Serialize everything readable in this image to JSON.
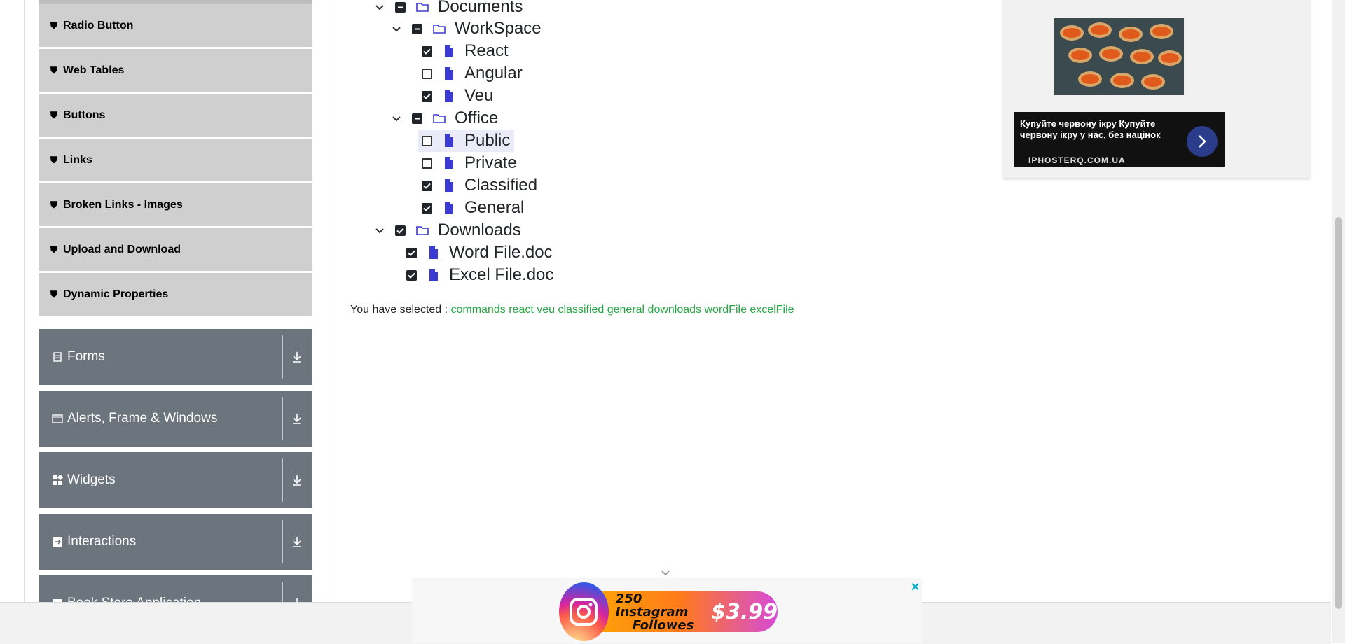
{
  "sidebar": {
    "elements_items": [
      {
        "label": "Radio Button"
      },
      {
        "label": "Web Tables"
      },
      {
        "label": "Buttons"
      },
      {
        "label": "Links"
      },
      {
        "label": "Broken Links - Images"
      },
      {
        "label": "Upload and Download"
      },
      {
        "label": "Dynamic Properties"
      }
    ],
    "groups": [
      {
        "label": "Forms",
        "icon": "form-icon"
      },
      {
        "label": "Alerts, Frame & Windows",
        "icon": "window-icon"
      },
      {
        "label": "Widgets",
        "icon": "widgets-icon"
      },
      {
        "label": "Interactions",
        "icon": "interactions-icon"
      },
      {
        "label": "Book Store Application",
        "icon": "book-icon"
      }
    ]
  },
  "tree": {
    "nodes": [
      {
        "label": "Documents",
        "state": "half",
        "type": "folder",
        "expanded": true
      },
      {
        "label": "WorkSpace",
        "state": "half",
        "type": "folder",
        "expanded": true
      },
      {
        "label": "React",
        "state": "checked",
        "type": "file"
      },
      {
        "label": "Angular",
        "state": "unchecked",
        "type": "file"
      },
      {
        "label": "Veu",
        "state": "checked",
        "type": "file"
      },
      {
        "label": "Office",
        "state": "half",
        "type": "folder",
        "expanded": true
      },
      {
        "label": "Public",
        "state": "unchecked",
        "type": "file",
        "highlighted": true
      },
      {
        "label": "Private",
        "state": "unchecked",
        "type": "file"
      },
      {
        "label": "Classified",
        "state": "checked",
        "type": "file"
      },
      {
        "label": "General",
        "state": "checked",
        "type": "file"
      },
      {
        "label": "Downloads",
        "state": "checked",
        "type": "folder",
        "expanded": true
      },
      {
        "label": "Word File.doc",
        "state": "checked",
        "type": "file"
      },
      {
        "label": "Excel File.doc",
        "state": "checked",
        "type": "file"
      }
    ]
  },
  "result": {
    "prefix": "You have selected :",
    "values": "commands react veu classified general downloads wordFile excelFile"
  },
  "side_ad": {
    "text": "Купуйте червону ікру Купуйте червону ікру у нас, без націнок",
    "domain": "IPHOSTERQ.COM.UA"
  },
  "bottom_ad": {
    "line1": "250 Instagram",
    "line2": "Followes",
    "price": "$3.99",
    "close": "✕"
  },
  "colors": {
    "accent_green": "#28a745",
    "sidebar_group": "#6c757d",
    "file_icon": "#3b3bd1"
  }
}
